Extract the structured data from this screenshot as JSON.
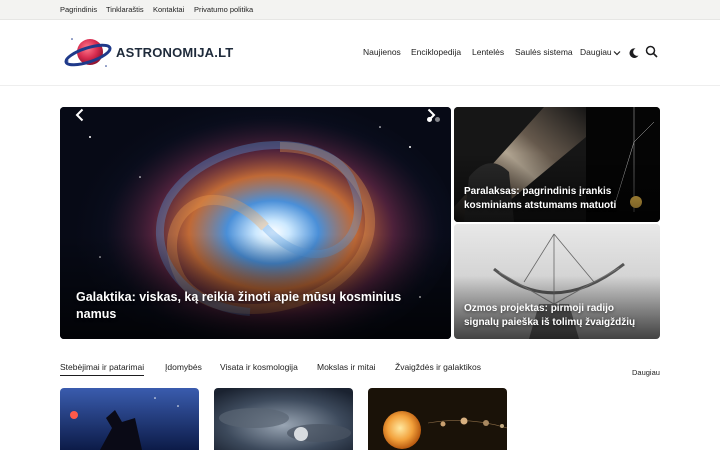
{
  "topbar": {
    "links": [
      "Pagrindinis",
      "Tinklaraštis",
      "Kontaktai",
      "Privatumo politika"
    ]
  },
  "header": {
    "site_name": "ASTRONOMIJA.LT",
    "nav": [
      "Naujienos",
      "Enciklopedija",
      "Lentelės",
      "Saulės sistema",
      "Daugiau"
    ],
    "icons": [
      "moon-icon",
      "search-icon",
      "chevron-down-icon"
    ]
  },
  "hero": {
    "main": {
      "title": "Galaktika: viskas, ką reikia žinoti apie mūsų kosminius namus",
      "slide_count": 2,
      "active_slide": 1
    },
    "side": [
      {
        "title": "Paralaksas: pagrindinis įrankis kosminiams atstumams matuoti"
      },
      {
        "title": "Ozmos projektas: pirmoji radijo signalų paieška iš tolimų žvaigždžių"
      }
    ]
  },
  "categories": {
    "tabs": [
      "Stebėjimai ir patarimai",
      "Įdomybės",
      "Visata ir kosmologija",
      "Mokslas ir mitai",
      "Žvaigždės ir galaktikos"
    ],
    "active_tab": 0,
    "more_label": "Daugiau"
  },
  "colors": {
    "topbar_bg": "#f3f3f1",
    "text": "#1d1d1f",
    "logo_planet": "#d62b4f",
    "logo_ring": "#1f3a8a"
  }
}
